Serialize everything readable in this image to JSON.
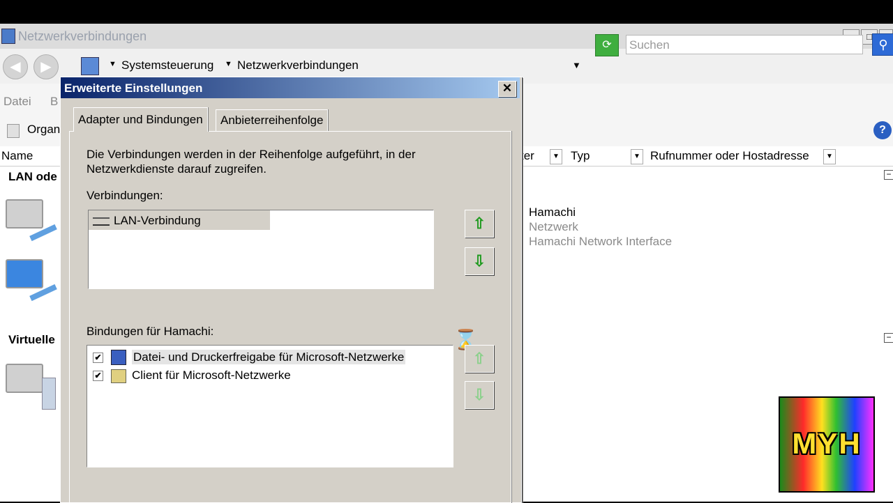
{
  "explorer": {
    "title": "Netzwerkverbindungen",
    "win_min": "_",
    "win_max": "□",
    "win_close": "X",
    "breadcrumb": [
      "Systemsteuerung",
      "Netzwerkverbindungen"
    ],
    "search_placeholder": "Suchen",
    "menu": [
      "Datei",
      "B"
    ],
    "organize": "Organ",
    "columns": [
      "Name",
      "ter",
      "Typ",
      "Rufnummer oder Hostadresse"
    ],
    "group_lan": "LAN ode",
    "group_virtual": "Virtuelle",
    "hamachi": {
      "name": "Hamachi",
      "status": "Netzwerk",
      "device": "Hamachi Network Interface"
    }
  },
  "dialog": {
    "title": "Erweiterte Einstellungen",
    "close": "✕",
    "tabs": [
      "Adapter und Bindungen",
      "Anbieterreihenfolge"
    ],
    "description_line1": "Die Verbindungen werden in der Reihenfolge aufgeführt, in der",
    "description_line2": "Netzwerkdienste darauf zugreifen.",
    "connections_label": "Verbindungen:",
    "connections": [
      "LAN-Verbindung"
    ],
    "bindings_label": "Bindungen für Hamachi:",
    "bindings": [
      {
        "label": "Datei- und Druckerfreigabe für Microsoft-Netzwerke",
        "checked": true
      },
      {
        "label": "Client für Microsoft-Netzwerke",
        "checked": true
      }
    ]
  },
  "watermark": "MYH",
  "colors": {
    "dialog_face": "#d4d0c8",
    "title_gradient_start": "#0a246a",
    "title_gradient_end": "#a6caf0",
    "arrow_green": "#1f9a1f"
  }
}
